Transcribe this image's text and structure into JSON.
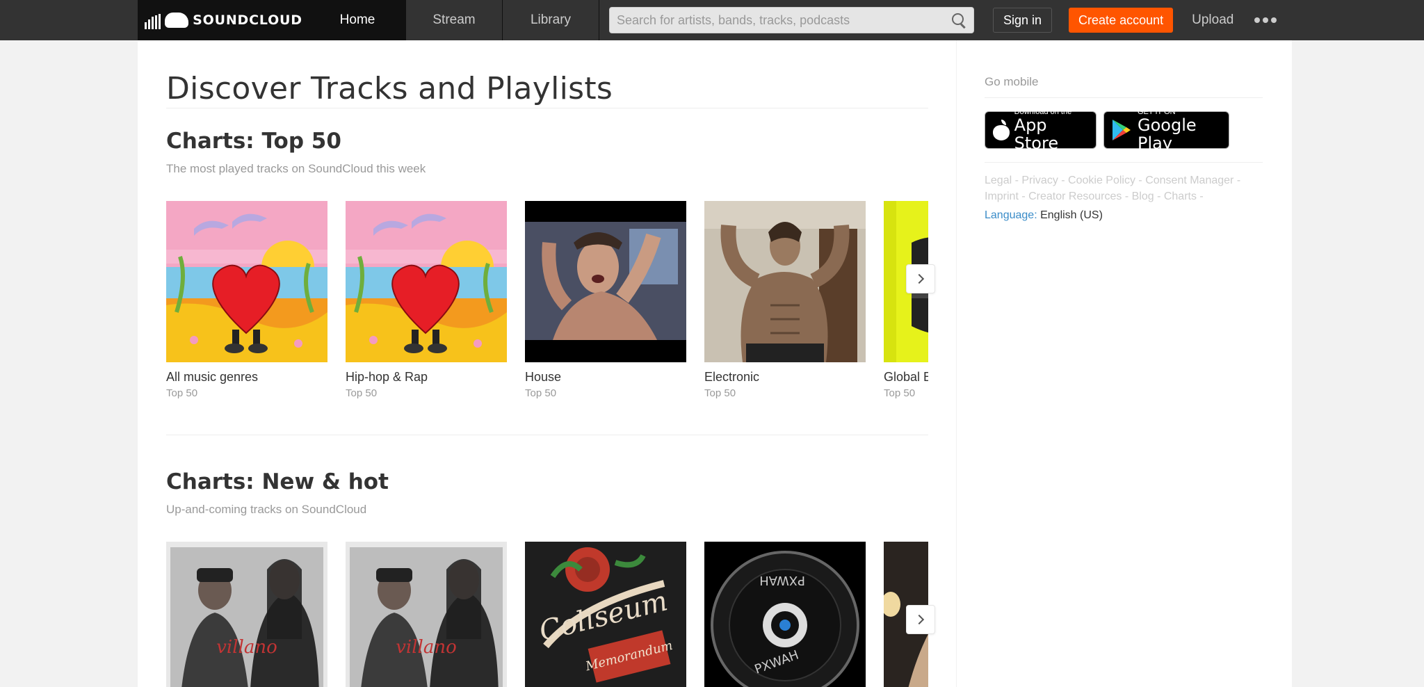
{
  "header": {
    "logo_text": "SOUNDCLOUD",
    "nav": [
      {
        "label": "Home",
        "active": true
      },
      {
        "label": "Stream",
        "active": false
      },
      {
        "label": "Library",
        "active": false
      }
    ],
    "search_placeholder": "Search for artists, bands, tracks, podcasts",
    "sign_in": "Sign in",
    "create_account": "Create account",
    "upload": "Upload",
    "accent_color": "#ff5500"
  },
  "main": {
    "title": "Discover Tracks and Playlists",
    "sections": [
      {
        "title": "Charts: Top 50",
        "subtitle": "The most played tracks on SoundCloud this week",
        "cards": [
          {
            "title": "All music genres",
            "sub": "Top 50",
            "art": "heart-beach"
          },
          {
            "title": "Hip-hop & Rap",
            "sub": "Top 50",
            "art": "heart-beach"
          },
          {
            "title": "House",
            "sub": "Top 50",
            "art": "photo-flex-dark"
          },
          {
            "title": "Electronic",
            "sub": "Top 50",
            "art": "photo-flex-muscle"
          },
          {
            "title": "Global Electronic",
            "sub": "Top 50",
            "art": "yellow-cover"
          }
        ]
      },
      {
        "title": "Charts: New & hot",
        "subtitle": "Up-and-coming tracks on SoundCloud",
        "cards": [
          {
            "title": "",
            "sub": "",
            "art": "duo-poster"
          },
          {
            "title": "",
            "sub": "",
            "art": "duo-poster"
          },
          {
            "title": "",
            "sub": "",
            "art": "rose-coliseum"
          },
          {
            "title": "",
            "sub": "",
            "art": "vinyl-disc"
          },
          {
            "title": "",
            "sub": "",
            "art": "dark-photo"
          }
        ]
      }
    ]
  },
  "sidebar": {
    "go_mobile": "Go mobile",
    "app_store": {
      "small": "Download on the",
      "big": "App Store"
    },
    "google_play": {
      "small": "GET IT ON",
      "big": "Google Play"
    },
    "footer_line1": "Legal - Privacy - Cookie Policy - Consent Manager -",
    "footer_line2": "Imprint - Creator Resources - Blog - Charts -",
    "language_label": "Language:",
    "language_value": "English (US)"
  }
}
